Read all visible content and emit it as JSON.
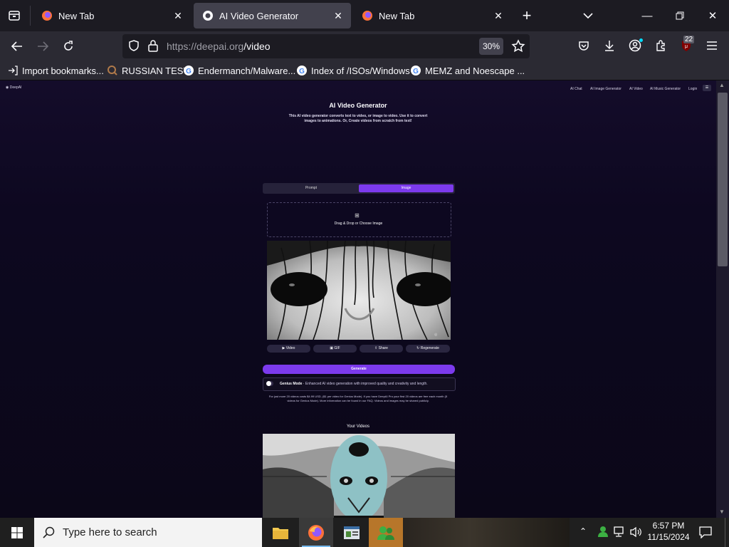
{
  "browser": {
    "tabs": [
      {
        "title": "New Tab"
      },
      {
        "title": "AI Video Generator"
      },
      {
        "title": "New Tab"
      }
    ],
    "url_host": "https://deepai.org",
    "url_path": "/video",
    "zoom": "30%",
    "notifications_badge": "22",
    "bookmarks": [
      "Import bookmarks...",
      "RUSSIAN TEST",
      "Endermanch/Malware...",
      "Index of /ISOs/Windows",
      "MEMZ and Noescape ..."
    ]
  },
  "site": {
    "logo": "DeepAI",
    "nav": [
      "AI Chat",
      "AI Image Generator",
      "AI Video",
      "AI Music Generator",
      "Login"
    ],
    "title": "AI Video Generator",
    "subtitle_line1": "This AI video generator converts text to video, or image to video. Use it to convert",
    "subtitle_line2": "images to animations. Or, Create videos from scratch from text!",
    "tabs": [
      "Prompt",
      "Image"
    ],
    "upload_label": "Drag & Drop or Choose Image",
    "action_buttons": [
      "Video",
      "GIF",
      "Share",
      "Regenerate"
    ],
    "generate_label": "Generate",
    "genius_title": "Genius Mode",
    "genius_desc": "Enhanced AI video generation with improved quality and creativity and length.",
    "pricing_line1": "For just more 20 videos costs $4.99 USD, ($1 per video for Genius Mode). If you have DeepAI Pro your first 20 videos are free each month (5",
    "pricing_line2": "videos for Genius Mode). More information can be found in our FAQ. Videos and images may be shared publicly.",
    "your_videos": "Your Videos"
  },
  "taskbar": {
    "search_placeholder": "Type here to search",
    "time": "6:57 PM",
    "date": "11/15/2024"
  },
  "colors": {
    "accent": "#7c3aed",
    "page_bg": "#0d0820"
  }
}
